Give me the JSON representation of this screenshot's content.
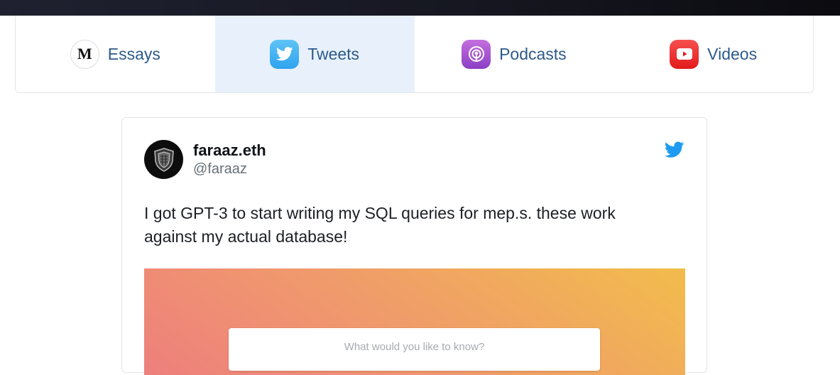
{
  "tabs": [
    {
      "label": "Essays",
      "icon": "medium-icon",
      "active": false
    },
    {
      "label": "Tweets",
      "icon": "twitter-icon",
      "active": true
    },
    {
      "label": "Podcasts",
      "icon": "podcast-icon",
      "active": false
    },
    {
      "label": "Videos",
      "icon": "youtube-icon",
      "active": false
    }
  ],
  "tabs_medium_glyph": "M",
  "tweet": {
    "author_name": "faraaz.eth",
    "author_handle": "@faraaz",
    "text": "I got GPT-3 to start writing my SQL queries for mep.s. these work against my actual database!",
    "media": {
      "search_placeholder": "What would you like to know?"
    }
  },
  "colors": {
    "tab_label": "#2c5a8a",
    "active_tab_bg": "#e8f1fb",
    "twitter_blue": "#1d9bf0"
  }
}
